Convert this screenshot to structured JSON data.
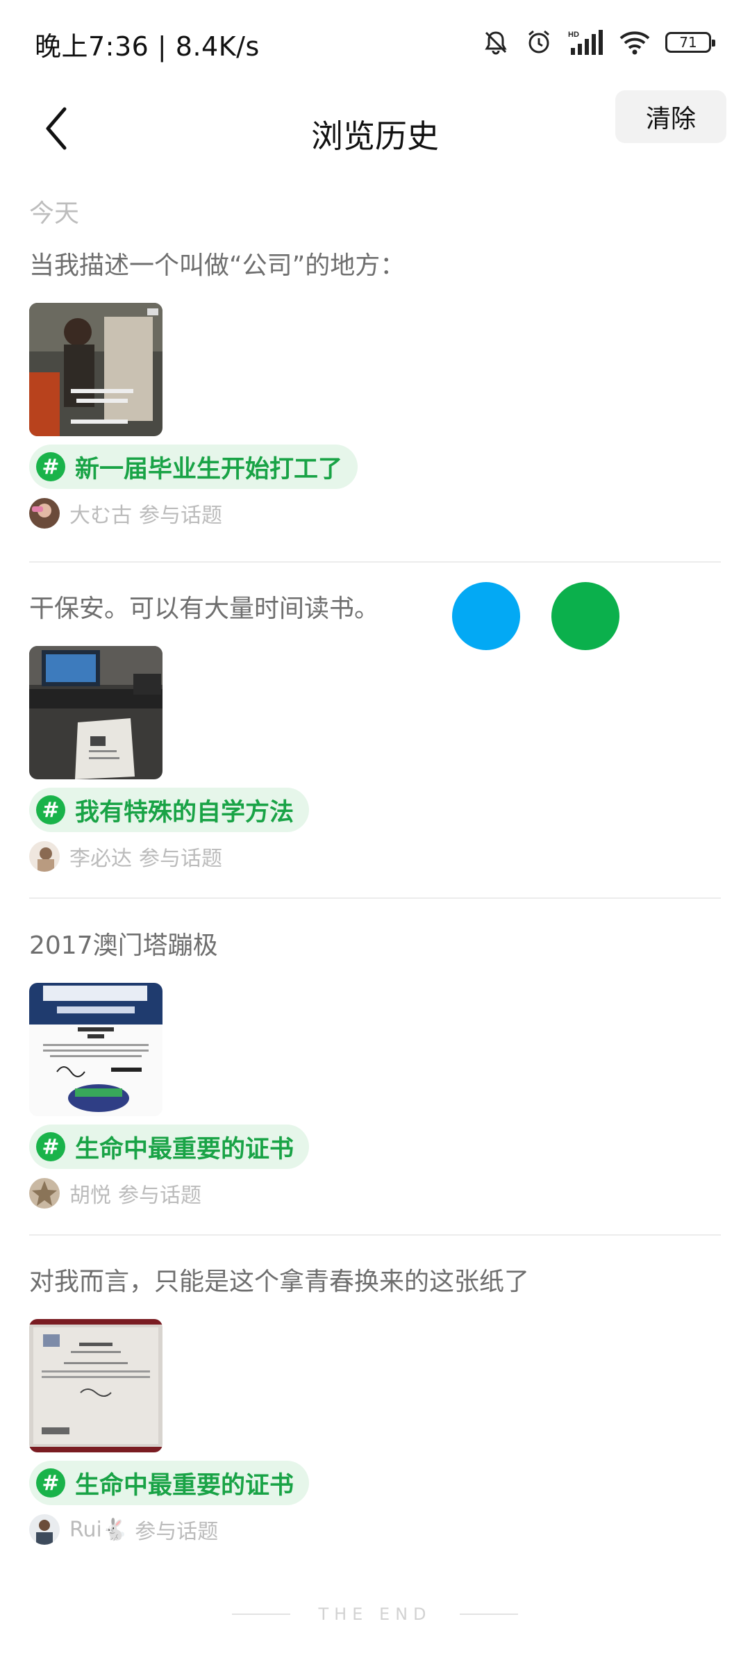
{
  "status_bar": {
    "time": "晚上7:36 | 8.4K/s",
    "battery": "71",
    "icons": [
      "mute-icon",
      "alarm-icon",
      "hd-signal-icon",
      "wifi-icon",
      "battery-icon"
    ]
  },
  "header": {
    "title": "浏览历史",
    "clear_label": "清除",
    "back_icon": "chevron-left-icon"
  },
  "section": {
    "label": "今天"
  },
  "posts": [
    {
      "text": "当我描述一个叫做“公司”的地方：",
      "topic": "新一届毕业生开始打工了",
      "user": "大む古",
      "suffix": "参与话题"
    },
    {
      "text": "干保安。可以有大量时间读书。",
      "topic": "我有特殊的自学方法",
      "user": "李必达",
      "suffix": "参与话题"
    },
    {
      "text": "2017澳门塔蹦极",
      "topic": "生命中最重要的证书",
      "user": "胡悦",
      "suffix": "参与话题"
    },
    {
      "text": "对我而言，只能是这个拿青春换来的这张纸了",
      "topic": "生命中最重要的证书",
      "user": "Rui🐇",
      "suffix": "参与话题"
    }
  ],
  "topic_icon_glyph": "#",
  "overlay_dots": {
    "colors": [
      "#03a9f4",
      "#0bb04c"
    ]
  },
  "footer": {
    "end_text": "THE END"
  },
  "colors": {
    "accent_green": "#19a346",
    "topic_bg": "#e6f6ea",
    "meta_gray": "#bbbbbb"
  }
}
